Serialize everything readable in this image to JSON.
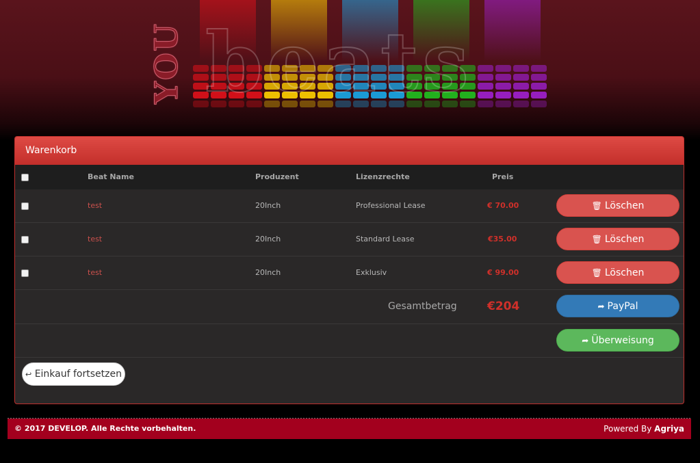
{
  "banner": {
    "logo_you": "YOU",
    "logo_beats": "beats",
    "eq_colors": [
      "#e0101a",
      "#ffd000",
      "#18a8e8",
      "#20c020",
      "#a020d0"
    ]
  },
  "cart": {
    "heading": "Warenkorb",
    "columns": {
      "name": "Beat Name",
      "producer": "Produzent",
      "license": "Lizenzrechte",
      "price": "Preis"
    },
    "items": [
      {
        "name": "test",
        "producer": "20Inch",
        "license": "Professional Lease",
        "price": "€ 70.00",
        "delete_label": "Löschen"
      },
      {
        "name": "test",
        "producer": "20Inch",
        "license": "Standard Lease",
        "price": "€35.00",
        "delete_label": "Löschen"
      },
      {
        "name": "test",
        "producer": "20Inch",
        "license": "Exklusiv",
        "price": "€ 99.00",
        "delete_label": "Löschen"
      }
    ],
    "total_label": "Gesamtbetrag",
    "total_value": "€204",
    "paypal_label": "PayPal",
    "transfer_label": "Überweisung",
    "continue_label": "Einkauf fortsetzen"
  },
  "footer": {
    "copyright": "© 2017 DEVELOP. Alle Rechte vorbehalten.",
    "powered_by": "Powered By",
    "brand": "Agriya"
  },
  "icons": {
    "trash": "trash-icon",
    "share": "share-icon",
    "back": "back-arrow-icon"
  }
}
